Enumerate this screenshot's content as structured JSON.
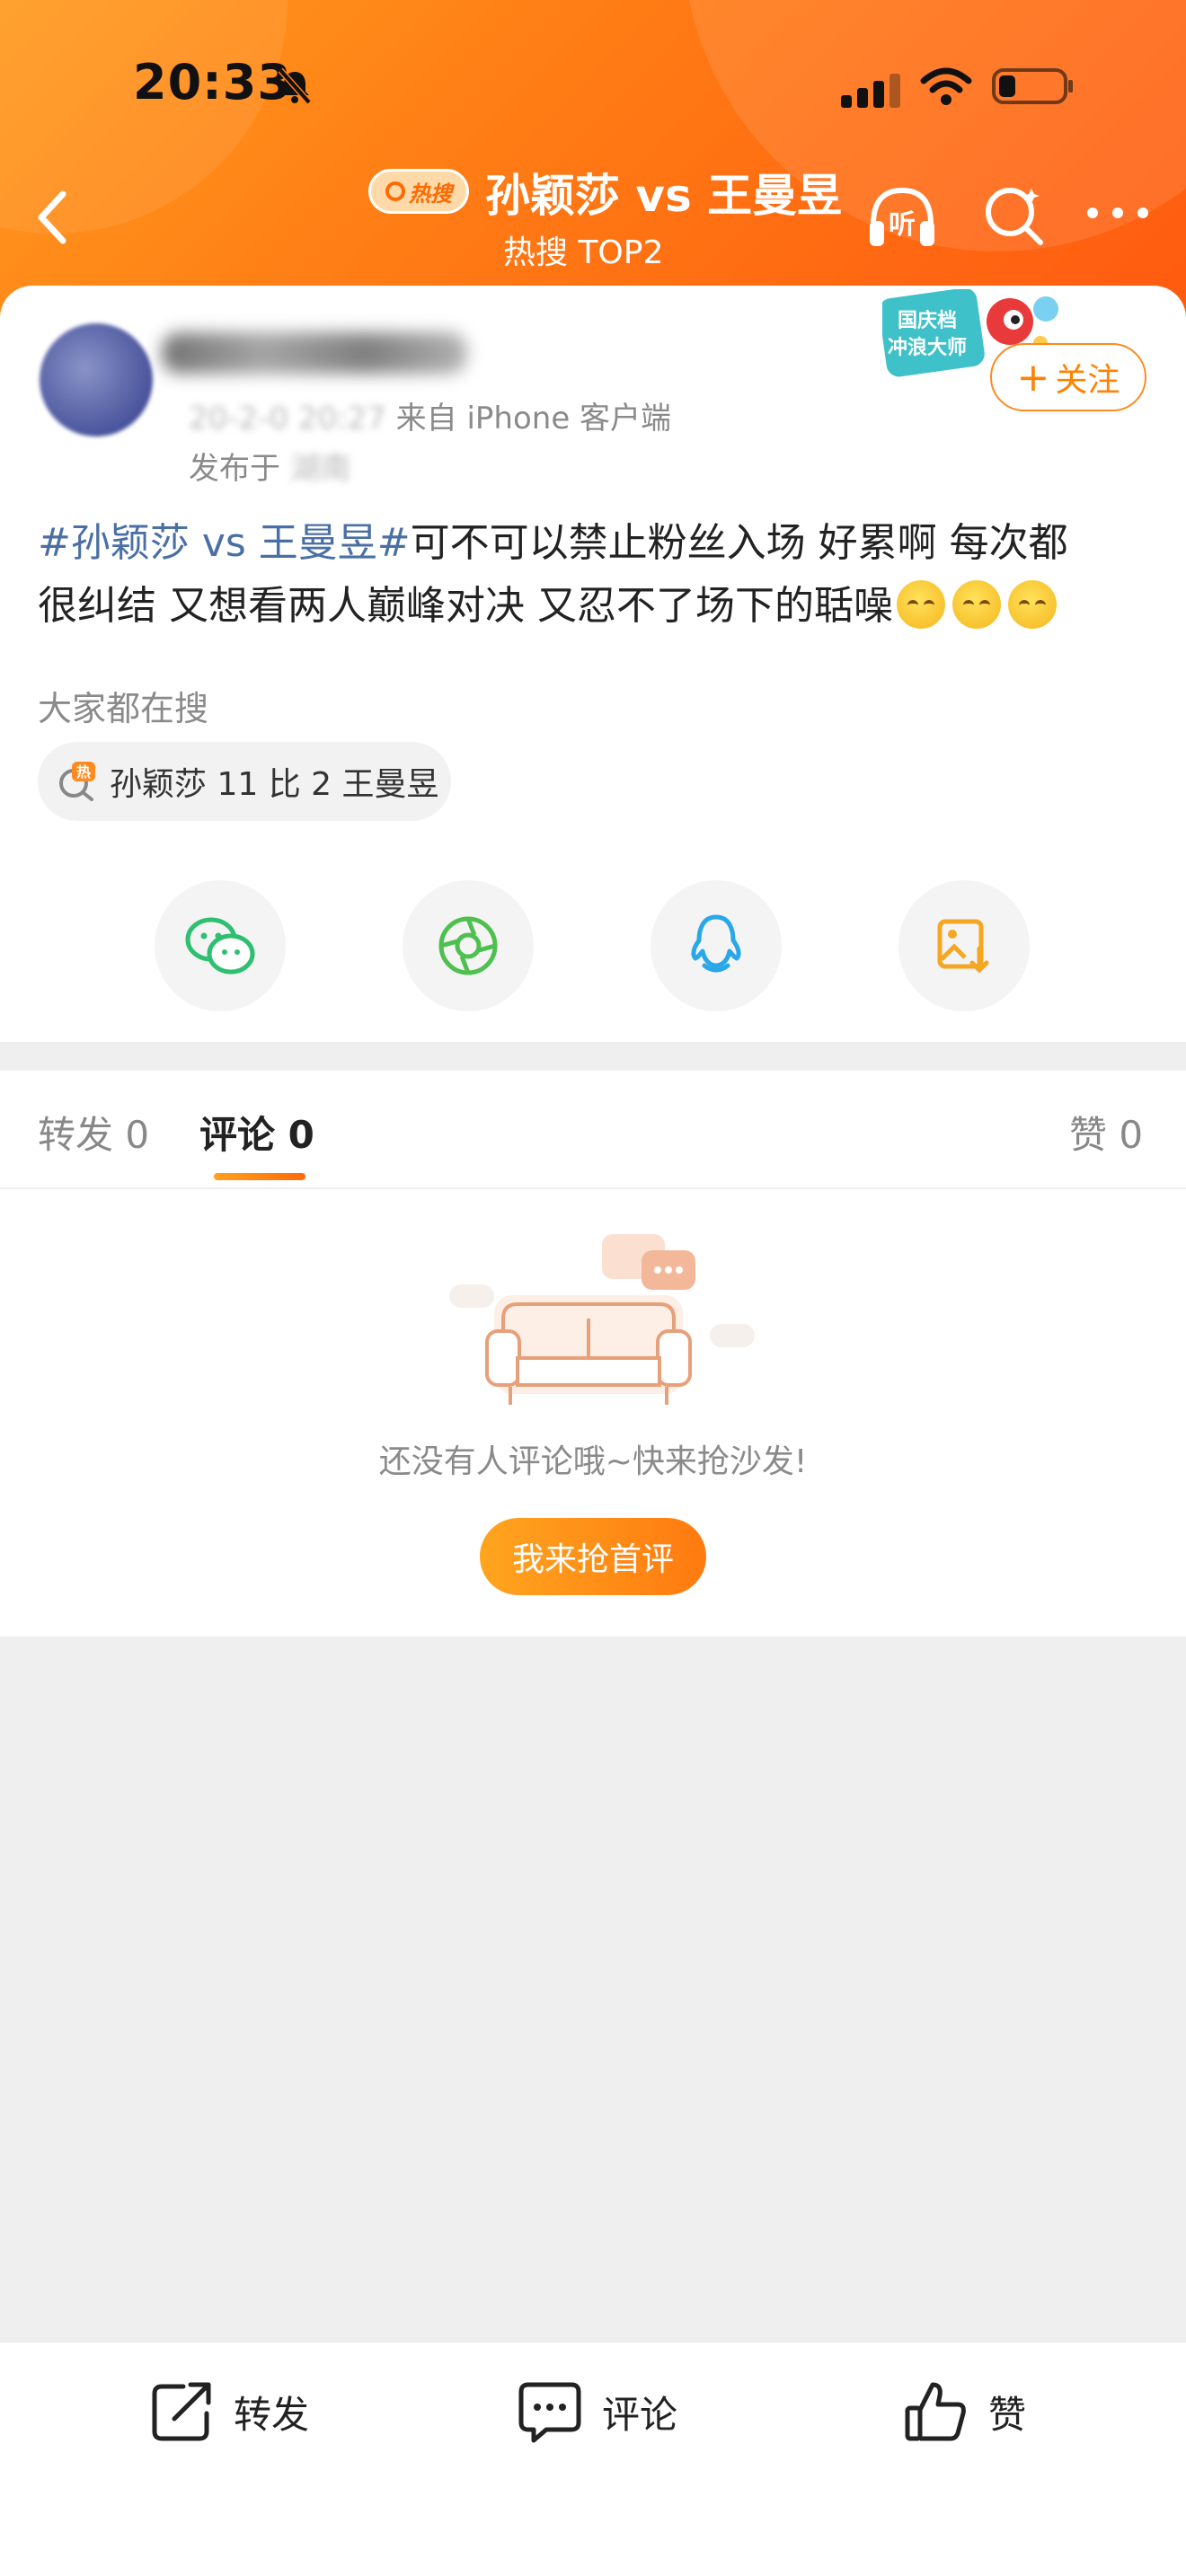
{
  "status_bar": {
    "time": "20:33"
  },
  "nav": {
    "badge": "热搜",
    "title": "孙颖莎 vs 王曼昱",
    "subtitle": "热搜 TOP2"
  },
  "post": {
    "meta_time": "20-2-0 20:27",
    "meta_source": "来自 iPhone 客户端",
    "location_prefix": "发布于",
    "location": "湖南",
    "follow_label": "关注",
    "event_badge_line1": "国庆档",
    "event_badge_line2": "冲浪大师",
    "topic": "#孙颖莎 vs 王曼昱#",
    "text_line1": "可不可以禁止粉丝入场  好累啊  每次都",
    "text_line2": "很纠结 又想看两人巅峰对决 又忍不了场下的聒噪"
  },
  "related_search": {
    "label": "大家都在搜",
    "chip_text": "孙颖莎 11 比 2 王曼昱"
  },
  "share": {
    "icons": [
      "wechat-icon",
      "moments-icon",
      "qq-icon",
      "save-image-icon"
    ]
  },
  "tabs": {
    "repost": "转发 0",
    "comment": "评论 0",
    "like": "赞 0"
  },
  "empty": {
    "text": "还没有人评论哦~快来抢沙发!",
    "button": "我来抢首评"
  },
  "bottom_bar": {
    "repost": "转发",
    "comment": "评论",
    "like": "赞"
  },
  "colors": {
    "brand_orange": "#ff7a14",
    "topic_blue": "#4a6fa5",
    "accent": "#ff8200"
  }
}
